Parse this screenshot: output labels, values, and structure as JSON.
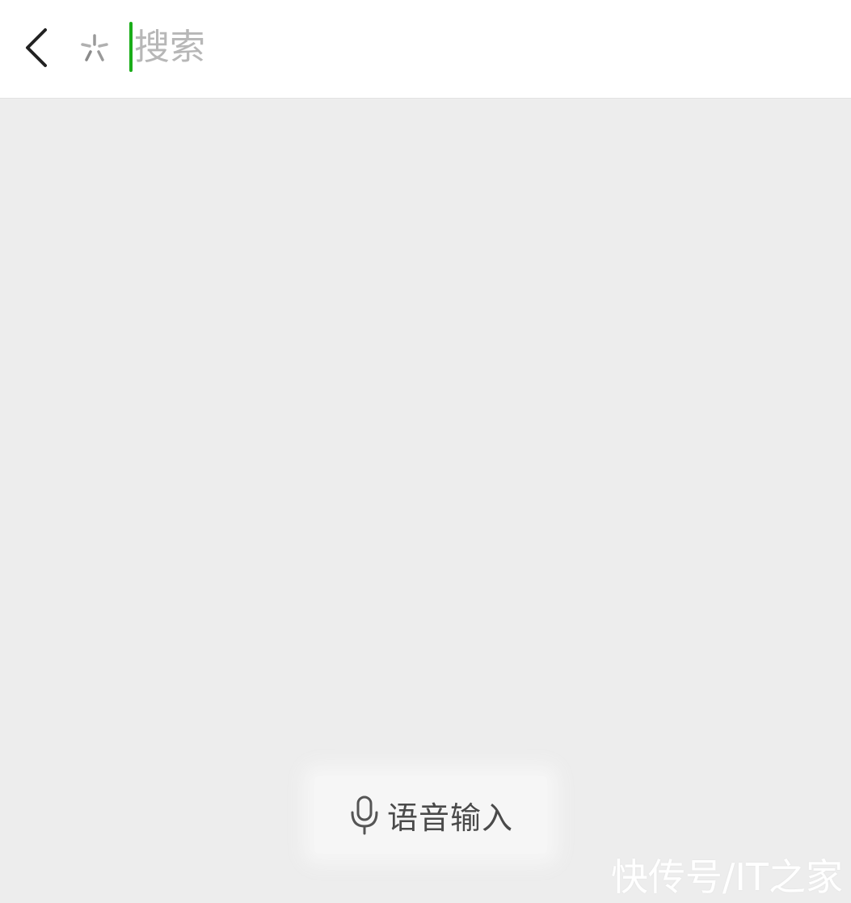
{
  "header": {
    "back_icon": "chevron-left-icon",
    "assistant_icon": "sparkle-icon",
    "search": {
      "value": "",
      "placeholder": "搜索"
    }
  },
  "voice_input": {
    "icon": "microphone-icon",
    "label": "语音输入"
  },
  "watermark": "快传号/IT之家",
  "colors": {
    "background": "#ededed",
    "header_background": "#ffffff",
    "caret": "#1aad19",
    "placeholder": "#b7b7b7",
    "voice_button": "#f6f6f6"
  }
}
